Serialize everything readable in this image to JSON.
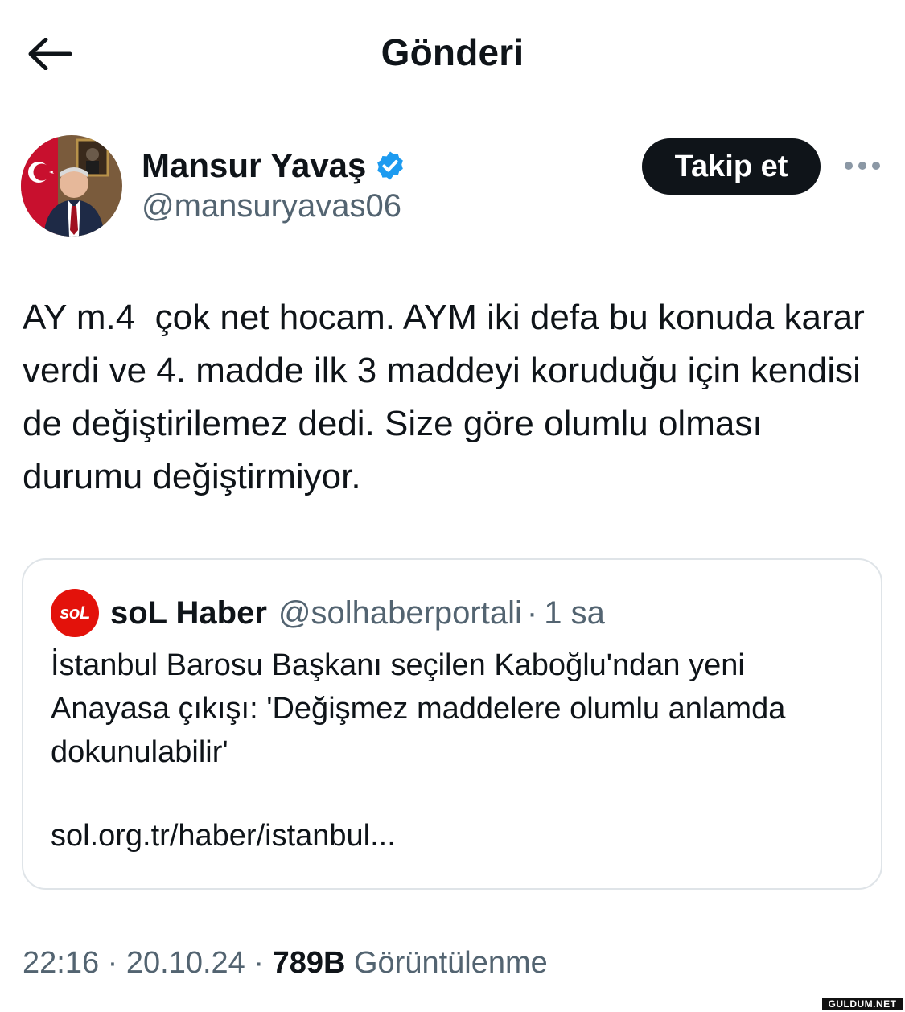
{
  "header": {
    "title": "Gönderi",
    "back_icon": "arrow-left-icon"
  },
  "author": {
    "name": "Mansur Yavaş",
    "handle": "@mansuryavas06",
    "verified_icon": "verified-badge-icon",
    "follow_label": "Takip et",
    "more_icon": "more-horizontal-icon"
  },
  "tweet": {
    "text": "AY m.4  çok net hocam. AYM iki defa bu konuda karar verdi ve 4. madde ilk 3 maddeyi koruduğu için kendisi de değiştirilemez dedi. Size göre olumlu olması durumu değiştirmiyor."
  },
  "quote": {
    "avatar_text": "soL",
    "name": "soL Haber",
    "handle": "@solhaberportali",
    "dot": "·",
    "time": "1 sa",
    "body": "İstanbul Barosu Başkanı seçilen Kaboğlu'ndan yeni Anayasa çıkışı: 'Değişmez maddelere olumlu anlamda dokunulabilir'",
    "link": "sol.org.tr/haber/istanbul..."
  },
  "meta": {
    "time": "22:16",
    "sep1": " · ",
    "date": "20.10.24",
    "sep2": " · ",
    "views": "789B",
    "views_label": " Görüntülenme"
  },
  "watermark": "GULDUM.NET",
  "colors": {
    "primary_text": "#0f1419",
    "secondary_text": "#536471",
    "verified_blue": "#1d9bf0",
    "quote_border": "#dfe4e8",
    "sol_red": "#e3120b"
  }
}
